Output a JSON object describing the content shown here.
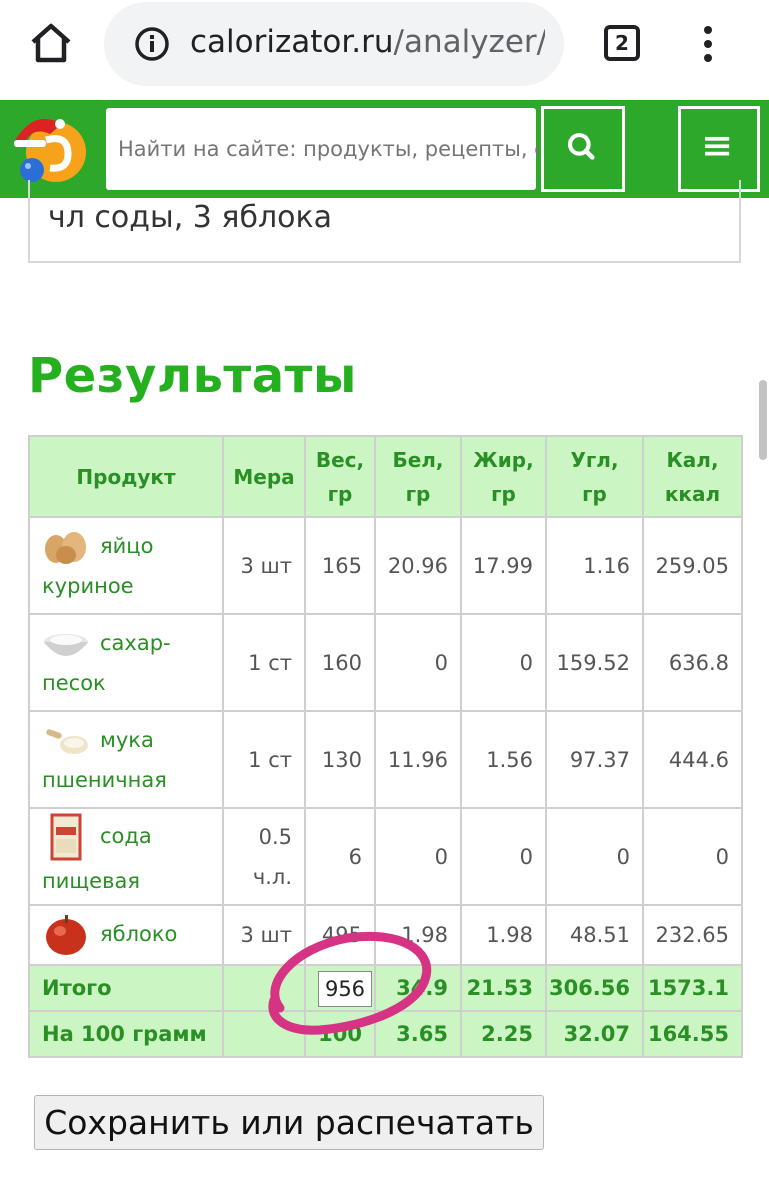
{
  "browser": {
    "url_domain": "calorizator.ru",
    "url_path": "/analyzer/",
    "tab_count": "2"
  },
  "site": {
    "search_placeholder": "Найти на сайте: продукты, рецепты, ст"
  },
  "content": {
    "ingredients_tail": "чл соды, 3 яблока",
    "results_title": "Результаты"
  },
  "table": {
    "headers": [
      "Продукт",
      "Мера",
      "Вес, гр",
      "Бел, гр",
      "Жир, гр",
      "Угл, гр",
      "Кал, ккал"
    ],
    "rows": [
      {
        "name_line1": "яйцо",
        "name_line2": "куриное",
        "icon": "egg-icon",
        "mera": "3 шт",
        "ves": "165",
        "bel": "20.96",
        "zhir": "17.99",
        "ugl": "1.16",
        "kal": "259.05"
      },
      {
        "name_line1": "сахар-",
        "name_line2": "песок",
        "icon": "sugar-bowl-icon",
        "mera": "1 ст",
        "ves": "160",
        "bel": "0",
        "zhir": "0",
        "ugl": "159.52",
        "kal": "636.8"
      },
      {
        "name_line1": "мука",
        "name_line2": "пшеничная",
        "icon": "flour-scoop-icon",
        "mera": "1 ст",
        "ves": "130",
        "bel": "11.96",
        "zhir": "1.56",
        "ugl": "97.37",
        "kal": "444.6"
      },
      {
        "name_line1": "сода",
        "name_line2": "пищевая",
        "icon": "soda-box-icon",
        "mera": "0.5 ч.л.",
        "ves": "6",
        "bel": "0",
        "zhir": "0",
        "ugl": "0",
        "kal": "0"
      },
      {
        "name_line1": "яблоко",
        "name_line2": "",
        "icon": "apple-icon",
        "mera": "3 шт",
        "ves": "495",
        "bel": "1.98",
        "zhir": "1.98",
        "ugl": "48.51",
        "kal": "232.65"
      }
    ],
    "total": {
      "label": "Итого",
      "ves": "956",
      "bel": "34.9",
      "zhir": "21.53",
      "ugl": "306.56",
      "kal": "1573.1"
    },
    "per100": {
      "label": "На 100 грамм",
      "ves": "100",
      "bel": "3.65",
      "zhir": "2.25",
      "ugl": "32.07",
      "kal": "164.55"
    }
  },
  "annotation": {
    "boxed_value": "956",
    "circle_color": "#d63384"
  },
  "buttons": {
    "print_label": "Сохранить или распечатать"
  },
  "colors": {
    "brand_green": "#2ea82b",
    "title_green": "#25b01f",
    "header_bg": "#ccf5c4"
  }
}
